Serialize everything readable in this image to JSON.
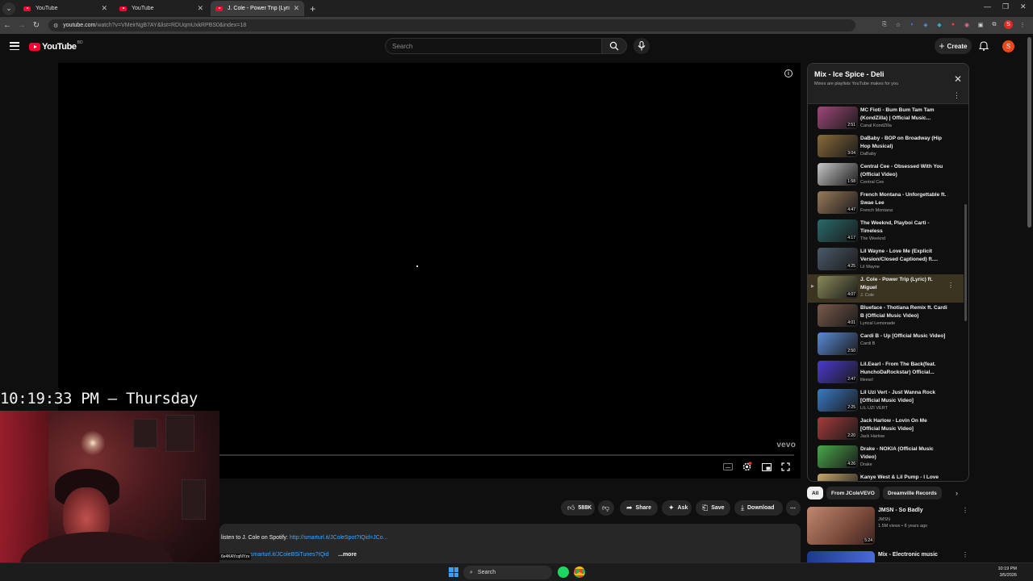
{
  "browser": {
    "tabs": [
      {
        "title": "YouTube",
        "active": false
      },
      {
        "title": "YouTube",
        "active": false
      },
      {
        "title": "J. Cole - Power Trip (Lyric) ft. M",
        "active": true
      }
    ],
    "url_host": "youtube.com",
    "url_rest": "/watch?v=VMeirNgB7AY&list=RDUqmUxkRPBS0&index=18",
    "profile_letter": "S"
  },
  "masthead": {
    "logo_text": "YouTube",
    "country": "BD",
    "search_placeholder": "Search",
    "create_label": "Create",
    "avatar_letter": "S"
  },
  "player": {
    "watermark": "vevo",
    "progress": 0
  },
  "overlay": {
    "clock_text": "10:19:33 PM – Thursday"
  },
  "actions": {
    "like_count": "588K",
    "share_label": "Share",
    "ask_label": "Ask",
    "save_label": "Save",
    "download_label": "Download"
  },
  "description": {
    "line1_prefix": "listen to J. Cole on Spotify: ",
    "line1_link": "http://smarturl.it/JColeSpot?IQid=JCo...",
    "line2_link": "smarturl.it/JColeBSiTunes?IQid",
    "more_label": "...more",
    "tooltip": "6e4KAYcqNYzv"
  },
  "playlist": {
    "title": "Mix - Ice Spice - Deli",
    "subtitle": "Mixes are playlists YouTube makes for you",
    "items": [
      {
        "title": "MC Fioti - Bum Bum Tam Tam (KondZilla) | Official Music...",
        "channel": "Canal KondZilla",
        "duration": "2:51",
        "color": "#a0487a"
      },
      {
        "title": "DaBaby - BOP on Broadway (Hip Hop Musical)",
        "channel": "DaBaby",
        "duration": "3:04",
        "color": "#8a6a3a"
      },
      {
        "title": "Central Cee - Obsessed With You (Official Video)",
        "channel": "Central Cee",
        "duration": "1:58",
        "color": "#c8c8c8"
      },
      {
        "title": "French Montana - Unforgettable ft. Swae Lee",
        "channel": "French Montana",
        "duration": "4:47",
        "color": "#9a7a5a"
      },
      {
        "title": "The Weeknd, Playboi Carti - Timeless",
        "channel": "The Weeknd",
        "duration": "4:17",
        "color": "#2a6a6a"
      },
      {
        "title": "Lil Wayne - Love Me (Explicit Version/Closed Captioned) ft....",
        "channel": "Lil Wayne",
        "duration": "4:25",
        "color": "#4a5a6a"
      },
      {
        "title": "J. Cole - Power Trip (Lyric) ft. Miguel",
        "channel": "J. Cole",
        "duration": "4:07",
        "color": "#8a8a5a",
        "active": true
      },
      {
        "title": "Blueface - Thotiana Remix ft. Cardi B (Official Music Video)",
        "channel": "Lyrical Lemonade",
        "duration": "4:01",
        "color": "#7a5a4a"
      },
      {
        "title": "Cardi B - Up [Official Music Video]",
        "channel": "Cardi B",
        "duration": "2:50",
        "color": "#5a8ad8"
      },
      {
        "title": "Lil.Eearl - From The Back(feat. HunchoDaRockstar) Official...",
        "channel": "lileearl",
        "duration": "2:47",
        "color": "#4a3ad0"
      },
      {
        "title": "Lil Uzi Vert - Just Wanna Rock [Official Music Video]",
        "channel": "LIL UZI VERT",
        "duration": "2:25",
        "color": "#3a7ac8"
      },
      {
        "title": "Jack Harlow - Lovin On Me [Official Music Video]",
        "channel": "Jack Harlow",
        "duration": "2:20",
        "color": "#a83a3a"
      },
      {
        "title": "Drake - NOKIA (Official Music Video)",
        "channel": "Drake",
        "duration": "4:26",
        "color": "#4aa84a"
      },
      {
        "title": "Kanye West & Lil Pump - I Love",
        "channel": "",
        "duration": "",
        "color": "#c8a86a"
      }
    ]
  },
  "chips": [
    "All",
    "From JColeVEVO",
    "Dreamville Records"
  ],
  "recommendations": [
    {
      "title": "JMSN - So Badly",
      "channel": "JMSN",
      "meta": "1.5M views • 8 years ago",
      "duration": "5:24",
      "color": "#a06a5a"
    },
    {
      "title": "Mix - Electronic music",
      "channel": "",
      "meta": "",
      "duration": "",
      "color": "#2a4a9a"
    }
  ],
  "taskbar": {
    "search_label": "Search",
    "time": "10:19 PM",
    "date": "3/5/2026"
  }
}
